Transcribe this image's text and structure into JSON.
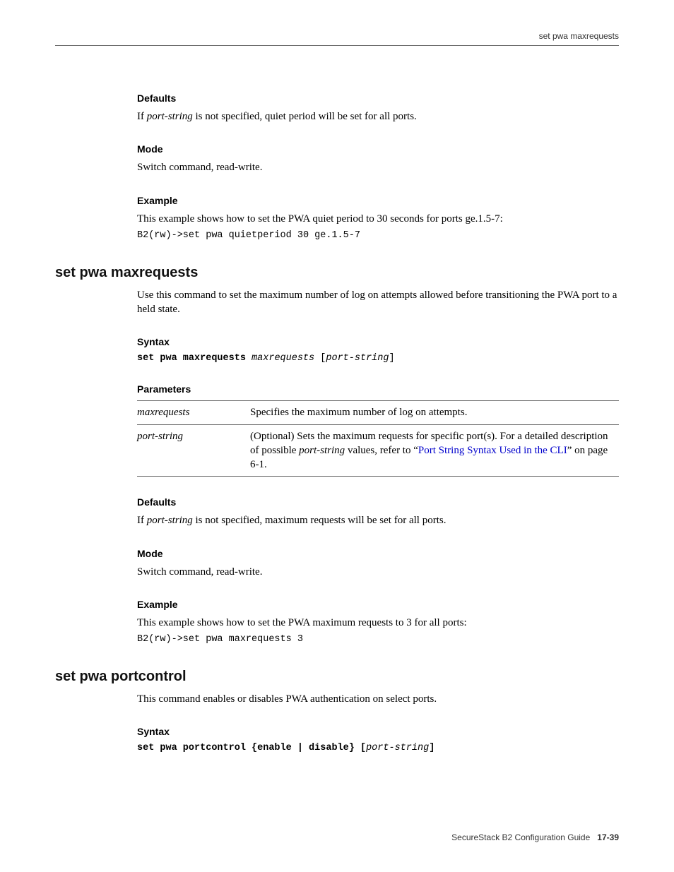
{
  "running_head": "set pwa maxrequests",
  "s1": {
    "defaults_h": "Defaults",
    "defaults_p_a": "If ",
    "defaults_p_b": "port-string",
    "defaults_p_c": " is not specified, quiet period will be set for all ports.",
    "mode_h": "Mode",
    "mode_p": "Switch command, read-write.",
    "example_h": "Example",
    "example_p": "This example shows how to set the PWA quiet period to 30 seconds for ports ge.1.5-7:",
    "example_code": "B2(rw)->set pwa quietperiod 30 ge.1.5-7"
  },
  "s2": {
    "title": "set pwa maxrequests",
    "intro": "Use this command to set the maximum number of log on attempts allowed before transitioning the PWA port to a held state.",
    "syntax_h": "Syntax",
    "syntax_code_a": "set pwa maxrequests",
    "syntax_code_b": " maxrequests ",
    "syntax_code_c": "[",
    "syntax_code_d": "port-string",
    "syntax_code_e": "]",
    "params_h": "Parameters",
    "param1_name": "maxrequests",
    "param1_desc": "Specifies the maximum number of log on attempts.",
    "param2_name": "port-string",
    "param2_desc_a": "(Optional) Sets the maximum requests for specific port(s). For a detailed description of possible ",
    "param2_desc_b": "port-string",
    "param2_desc_c": " values, refer to “",
    "param2_link": "Port String Syntax Used in the CLI",
    "param2_desc_d": "” on page 6-1.",
    "defaults_h": "Defaults",
    "defaults_p_a": "If ",
    "defaults_p_b": "port-string",
    "defaults_p_c": " is not specified, maximum requests will be set for all ports.",
    "mode_h": "Mode",
    "mode_p": "Switch command, read-write.",
    "example_h": "Example",
    "example_p": "This example shows how to set the PWA maximum requests to 3 for all ports:",
    "example_code": "B2(rw)->set pwa maxrequests 3"
  },
  "s3": {
    "title": "set pwa portcontrol",
    "intro": "This command enables or disables PWA authentication on select ports.",
    "syntax_h": "Syntax",
    "syntax_code_a": "set pwa portcontrol {enable | disable} [",
    "syntax_code_b": "port-string",
    "syntax_code_c": "]"
  },
  "footer_a": "SecureStack B2 Configuration Guide",
  "footer_b": "17-39"
}
